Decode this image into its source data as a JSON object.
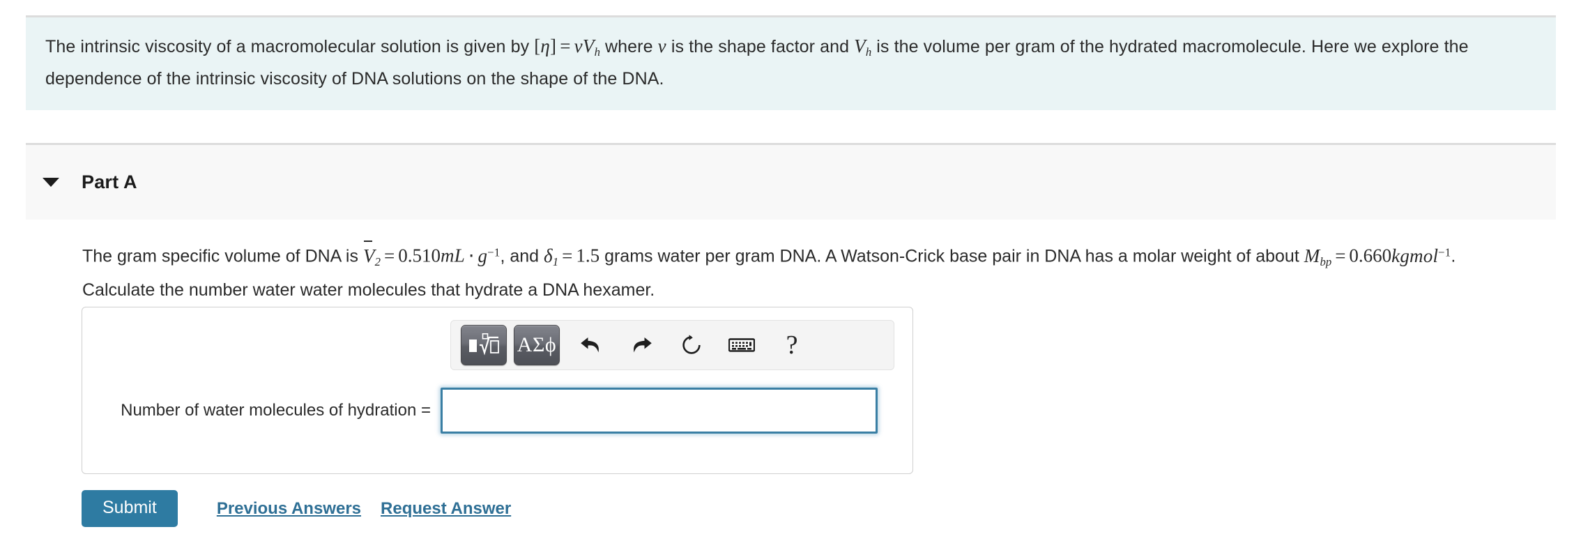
{
  "intro": {
    "text_part1": "The intrinsic viscosity of a macromolecular solution is given by",
    "math1_lb": "[",
    "math1_eta": "η",
    "math1_rb": "]",
    "math1_eq": "=",
    "math1_nu": "ν",
    "math1_V": "V",
    "math1_Vsub": "h",
    "text_part2": "where",
    "math2_nu": "ν",
    "text_part3": "is the shape factor and",
    "math3_V": "V",
    "math3_Vsub": "h",
    "text_part4": "is the volume per gram of the hydrated macromolecule. Here we explore the dependence of the intrinsic viscosity of DNA solutions on the shape of the DNA.",
    "background_color": "#eaf4f5"
  },
  "part": {
    "title": "Part A",
    "disclosure_state": "expanded"
  },
  "question": {
    "line1_a": "The gram specific volume of DNA is",
    "m_V": "V",
    "m_Vsub": "2",
    "m_eq1": "=",
    "m_val1": "0.510",
    "m_unit1": "mL",
    "m_cdot": "⋅",
    "m_g": "g",
    "m_gexp": "−1",
    "line1_b": ", and",
    "m_delta": "δ",
    "m_deltasub": "1",
    "m_eq2": "=",
    "m_val2": "1.5",
    "line1_c": "grams water per gram DNA. A Watson-Crick base pair in DNA has a molar weight of about",
    "m_M": "M",
    "m_Msub": "bp",
    "m_eq3": "=",
    "m_val3": "0.660",
    "m_unit3": "kgmol",
    "m_unit3exp": "−1",
    "line2_b": ". Calculate the number water water molecules that hydrate a DNA hexamer."
  },
  "answer": {
    "label": "Number of water molecules of hydration =",
    "value": "",
    "placeholder": ""
  },
  "toolbar": {
    "template_button": "template-math-button",
    "symbols_button_label": "ΑΣϕ",
    "undo_label": "undo-icon",
    "redo_label": "redo-icon",
    "reset_label": "reset-icon",
    "keyboard_label": "keyboard-icon",
    "help_label": "?"
  },
  "footer": {
    "submit_label": "Submit",
    "previous_answers_label": "Previous Answers",
    "request_answer_label": "Request Answer",
    "submit_color": "#2e7ba2",
    "link_color": "#2e6f95"
  }
}
